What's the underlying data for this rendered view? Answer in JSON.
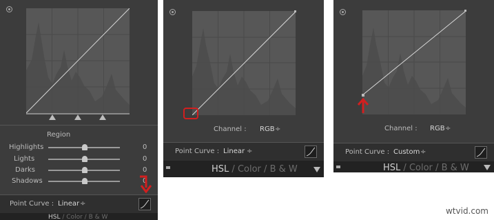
{
  "panels": [
    {
      "regions": {
        "title": "Region",
        "sliders": [
          {
            "label": "Highlights",
            "value": "0"
          },
          {
            "label": "Lights",
            "value": "0"
          },
          {
            "label": "Darks",
            "value": "0"
          },
          {
            "label": "Shadows",
            "value": "0"
          }
        ]
      },
      "point_curve": {
        "label": "Point Curve :",
        "value": "Linear",
        "arrows": "÷"
      },
      "tabs": {
        "hsl": "HSL",
        "sep": "/",
        "color": "Color",
        "bw": "B & W"
      }
    },
    {
      "channel": {
        "label": "Channel :",
        "value": "RGB",
        "arrows": "÷"
      },
      "point_curve": {
        "label": "Point Curve :",
        "value": "Linear",
        "arrows": "÷"
      },
      "tabs": {
        "hsl": "HSL",
        "sep": "/",
        "color": "Color",
        "bw": "B & W"
      }
    },
    {
      "channel": {
        "label": "Channel :",
        "value": "RGB",
        "arrows": "÷"
      },
      "point_curve": {
        "label": "Point Curve :",
        "value": "Custom",
        "arrows": "÷"
      },
      "tabs": {
        "hsl": "HSL",
        "sep": "/",
        "color": "Color",
        "bw": "B & W"
      }
    }
  ],
  "watermark": "wtvid.com",
  "colors": {
    "panel": "#3c3c3c",
    "histogram": "#575757",
    "annotation": "#d21f1f",
    "curve": "#d8d8d8"
  }
}
